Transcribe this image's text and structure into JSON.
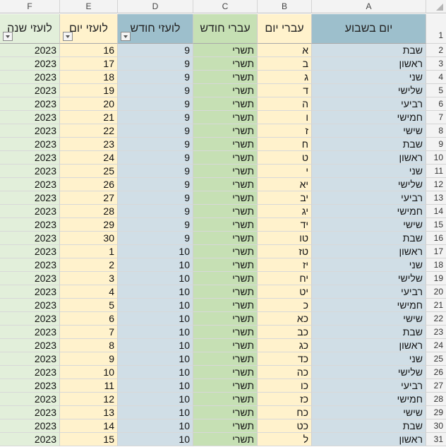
{
  "columns": [
    "F",
    "E",
    "D",
    "C",
    "B",
    "A"
  ],
  "colors": {
    "col_F": "#e2efda",
    "col_E": "#fff2cc",
    "col_D": "#d0dee6",
    "col_C": "#c6e0b4",
    "col_B": "#fff2cc",
    "col_A": "#d0dee6",
    "head_D": "#9dbfcc",
    "head_A": "#9dbfcc"
  },
  "header": {
    "F": "לועזי שנה",
    "E": "לועזי יום",
    "D": "לועזי חודש",
    "C": "עברי חודש",
    "B": "עברי יום",
    "A": "יום בשבוע",
    "row_number": "1"
  },
  "rows": [
    {
      "n": "2",
      "A": "שבת",
      "B": "א",
      "C": "תשרי",
      "D": "9",
      "E": "16",
      "F": "2023"
    },
    {
      "n": "3",
      "A": "ראשון",
      "B": "ב",
      "C": "תשרי",
      "D": "9",
      "E": "17",
      "F": "2023"
    },
    {
      "n": "4",
      "A": "שני",
      "B": "ג",
      "C": "תשרי",
      "D": "9",
      "E": "18",
      "F": "2023"
    },
    {
      "n": "5",
      "A": "שלישי",
      "B": "ד",
      "C": "תשרי",
      "D": "9",
      "E": "19",
      "F": "2023"
    },
    {
      "n": "6",
      "A": "רביעי",
      "B": "ה",
      "C": "תשרי",
      "D": "9",
      "E": "20",
      "F": "2023"
    },
    {
      "n": "7",
      "A": "חמישי",
      "B": "ו",
      "C": "תשרי",
      "D": "9",
      "E": "21",
      "F": "2023"
    },
    {
      "n": "8",
      "A": "שישי",
      "B": "ז",
      "C": "תשרי",
      "D": "9",
      "E": "22",
      "F": "2023"
    },
    {
      "n": "9",
      "A": "שבת",
      "B": "ח",
      "C": "תשרי",
      "D": "9",
      "E": "23",
      "F": "2023"
    },
    {
      "n": "10",
      "A": "ראשון",
      "B": "ט",
      "C": "תשרי",
      "D": "9",
      "E": "24",
      "F": "2023"
    },
    {
      "n": "11",
      "A": "שני",
      "B": "י",
      "C": "תשרי",
      "D": "9",
      "E": "25",
      "F": "2023"
    },
    {
      "n": "12",
      "A": "שלישי",
      "B": "יא",
      "C": "תשרי",
      "D": "9",
      "E": "26",
      "F": "2023"
    },
    {
      "n": "13",
      "A": "רביעי",
      "B": "יב",
      "C": "תשרי",
      "D": "9",
      "E": "27",
      "F": "2023"
    },
    {
      "n": "14",
      "A": "חמישי",
      "B": "יג",
      "C": "תשרי",
      "D": "9",
      "E": "28",
      "F": "2023"
    },
    {
      "n": "15",
      "A": "שישי",
      "B": "יד",
      "C": "תשרי",
      "D": "9",
      "E": "29",
      "F": "2023"
    },
    {
      "n": "16",
      "A": "שבת",
      "B": "טו",
      "C": "תשרי",
      "D": "9",
      "E": "30",
      "F": "2023"
    },
    {
      "n": "17",
      "A": "ראשון",
      "B": "טז",
      "C": "תשרי",
      "D": "10",
      "E": "1",
      "F": "2023"
    },
    {
      "n": "18",
      "A": "שני",
      "B": "יז",
      "C": "תשרי",
      "D": "10",
      "E": "2",
      "F": "2023"
    },
    {
      "n": "19",
      "A": "שלישי",
      "B": "יח",
      "C": "תשרי",
      "D": "10",
      "E": "3",
      "F": "2023"
    },
    {
      "n": "20",
      "A": "רביעי",
      "B": "יט",
      "C": "תשרי",
      "D": "10",
      "E": "4",
      "F": "2023"
    },
    {
      "n": "21",
      "A": "חמישי",
      "B": "כ",
      "C": "תשרי",
      "D": "10",
      "E": "5",
      "F": "2023"
    },
    {
      "n": "22",
      "A": "שישי",
      "B": "כא",
      "C": "תשרי",
      "D": "10",
      "E": "6",
      "F": "2023"
    },
    {
      "n": "23",
      "A": "שבת",
      "B": "כב",
      "C": "תשרי",
      "D": "10",
      "E": "7",
      "F": "2023"
    },
    {
      "n": "24",
      "A": "ראשון",
      "B": "כג",
      "C": "תשרי",
      "D": "10",
      "E": "8",
      "F": "2023"
    },
    {
      "n": "25",
      "A": "שני",
      "B": "כד",
      "C": "תשרי",
      "D": "10",
      "E": "9",
      "F": "2023"
    },
    {
      "n": "26",
      "A": "שלישי",
      "B": "כה",
      "C": "תשרי",
      "D": "10",
      "E": "10",
      "F": "2023"
    },
    {
      "n": "27",
      "A": "רביעי",
      "B": "כו",
      "C": "תשרי",
      "D": "10",
      "E": "11",
      "F": "2023"
    },
    {
      "n": "28",
      "A": "חמישי",
      "B": "כז",
      "C": "תשרי",
      "D": "10",
      "E": "12",
      "F": "2023"
    },
    {
      "n": "29",
      "A": "שישי",
      "B": "כח",
      "C": "תשרי",
      "D": "10",
      "E": "13",
      "F": "2023"
    },
    {
      "n": "30",
      "A": "שבת",
      "B": "כט",
      "C": "תשרי",
      "D": "10",
      "E": "14",
      "F": "2023"
    },
    {
      "n": "31",
      "A": "ראשון",
      "B": "ל",
      "C": "תשרי",
      "D": "10",
      "E": "15",
      "F": "2023"
    }
  ]
}
